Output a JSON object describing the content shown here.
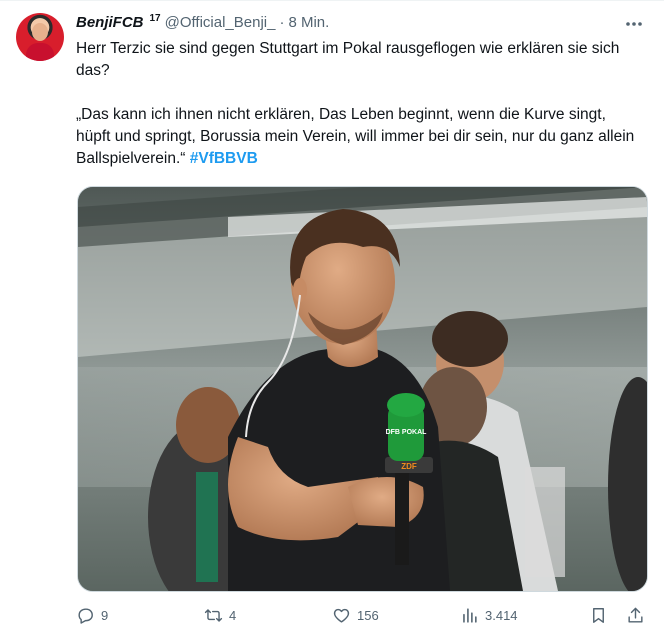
{
  "author": {
    "display_name": "BenjiFCB",
    "badge": "17",
    "handle": "@Official_Benji_",
    "separator": "·",
    "timestamp": "8 Min."
  },
  "tweet": {
    "paragraph1": "Herr Terzic sie sind gegen Stuttgart im Pokal rausgeflogen wie erklären sie sich das?",
    "paragraph2": "„Das kann ich ihnen nicht erklären, Das Leben beginnt, wenn die Kurve singt, hüpft und springt, Borussia mein Verein, will immer bei dir sein, nur du ganz allein Ballspielverein.“",
    "hashtag": "#VfBBVB",
    "media": {
      "microphone_label": "DFB POKAL",
      "microphone_brand": "ZDF"
    }
  },
  "actions": {
    "replies": "9",
    "reposts": "4",
    "likes": "156",
    "views": "3.414"
  },
  "icons": [
    "more-icon",
    "reply-icon",
    "repost-icon",
    "like-icon",
    "views-icon",
    "bookmark-icon",
    "share-icon"
  ],
  "colors": {
    "text": "#0f1419",
    "secondary": "#536471",
    "hashtag": "#1d9bf0",
    "mic_green": "#1f9a3a"
  }
}
